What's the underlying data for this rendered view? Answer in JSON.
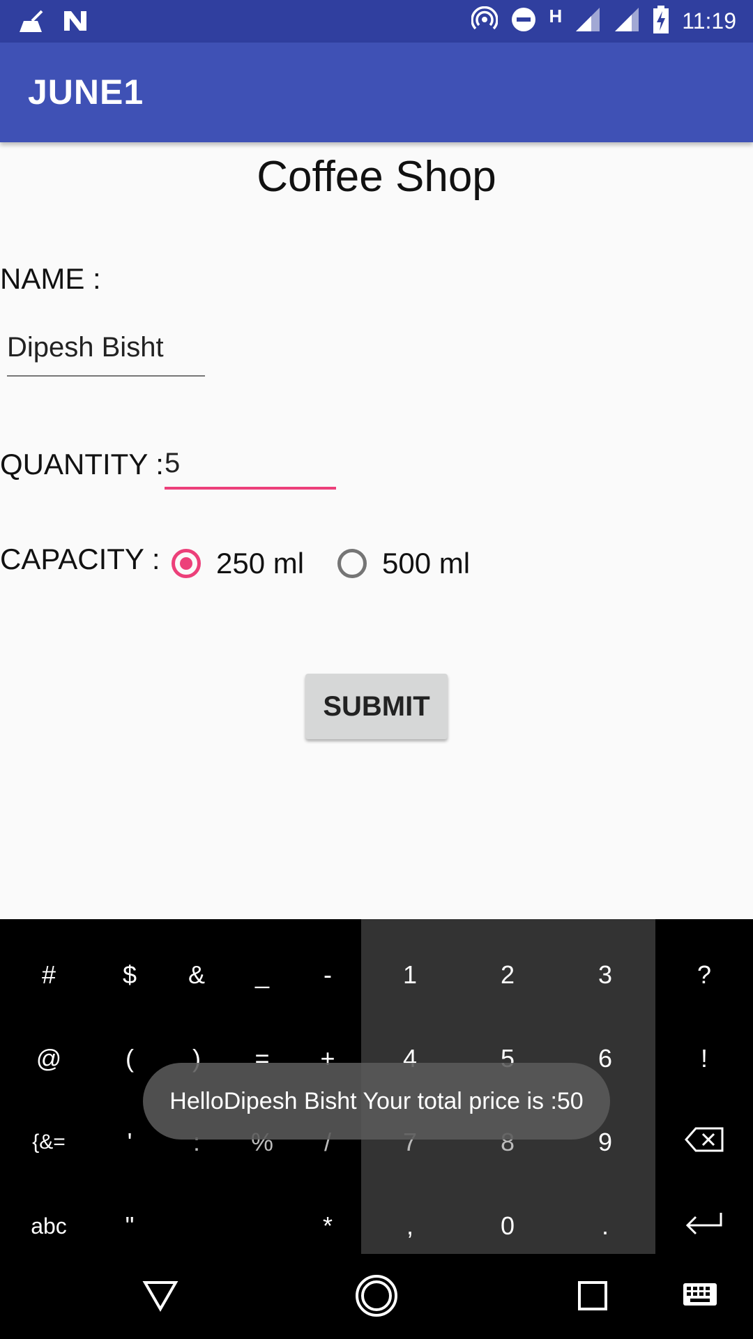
{
  "status_bar": {
    "time": "11:19",
    "network_label": "H",
    "icons": [
      "cleaner-icon",
      "n-icon",
      "hotspot-icon",
      "dnd-icon",
      "signal-icon",
      "signal-icon",
      "battery-icon"
    ]
  },
  "app_bar": {
    "title": "JUNE1"
  },
  "form": {
    "page_title": "Coffee Shop",
    "name_label": "NAME :",
    "name_value": "Dipesh Bisht",
    "quantity_label": "QUANTITY :",
    "quantity_value": "5",
    "capacity_label": "CAPACITY :",
    "capacity_options": [
      {
        "label": "250 ml",
        "checked": true
      },
      {
        "label": "500 ml",
        "checked": false
      }
    ],
    "submit_label": "SUBMIT"
  },
  "keyboard": {
    "rows": [
      [
        "#",
        "$",
        "&",
        "_",
        "-",
        "1",
        "2",
        "3",
        "?"
      ],
      [
        "@",
        "(",
        ")",
        "=",
        "+",
        "4",
        "5",
        "6",
        "!"
      ],
      [
        "{&=",
        "'",
        ":",
        "%",
        "/",
        "7",
        "8",
        "9",
        "⌫"
      ],
      [
        "abc",
        "\"",
        "",
        "",
        "*",
        ",",
        "0",
        ".",
        "↵"
      ]
    ]
  },
  "toast": {
    "message": "HelloDipesh Bisht Your total price is :50"
  },
  "nav_bar": {
    "buttons": [
      "back",
      "home",
      "recents",
      "keyboard"
    ]
  },
  "colors": {
    "status_bar": "#303f9f",
    "app_bar": "#3f51b5",
    "accent": "#ec407a"
  }
}
